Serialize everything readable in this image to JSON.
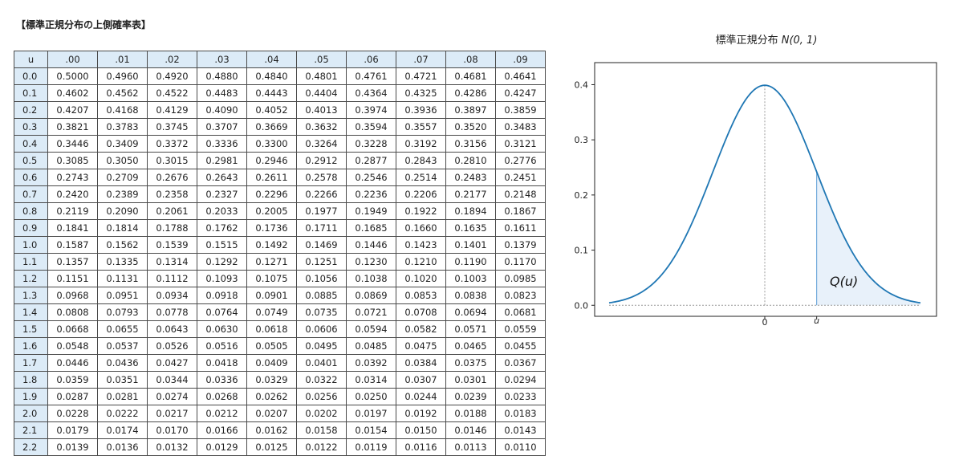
{
  "document": {
    "title": "【標準正規分布の上側確率表】"
  },
  "table": {
    "corner_label": "u",
    "column_headers": [
      ".00",
      ".01",
      ".02",
      ".03",
      ".04",
      ".05",
      ".06",
      ".07",
      ".08",
      ".09"
    ],
    "rows": [
      {
        "u": "0.0",
        "values": [
          "0.5000",
          "0.4960",
          "0.4920",
          "0.4880",
          "0.4840",
          "0.4801",
          "0.4761",
          "0.4721",
          "0.4681",
          "0.4641"
        ]
      },
      {
        "u": "0.1",
        "values": [
          "0.4602",
          "0.4562",
          "0.4522",
          "0.4483",
          "0.4443",
          "0.4404",
          "0.4364",
          "0.4325",
          "0.4286",
          "0.4247"
        ]
      },
      {
        "u": "0.2",
        "values": [
          "0.4207",
          "0.4168",
          "0.4129",
          "0.4090",
          "0.4052",
          "0.4013",
          "0.3974",
          "0.3936",
          "0.3897",
          "0.3859"
        ]
      },
      {
        "u": "0.3",
        "values": [
          "0.3821",
          "0.3783",
          "0.3745",
          "0.3707",
          "0.3669",
          "0.3632",
          "0.3594",
          "0.3557",
          "0.3520",
          "0.3483"
        ]
      },
      {
        "u": "0.4",
        "values": [
          "0.3446",
          "0.3409",
          "0.3372",
          "0.3336",
          "0.3300",
          "0.3264",
          "0.3228",
          "0.3192",
          "0.3156",
          "0.3121"
        ]
      },
      {
        "u": "0.5",
        "values": [
          "0.3085",
          "0.3050",
          "0.3015",
          "0.2981",
          "0.2946",
          "0.2912",
          "0.2877",
          "0.2843",
          "0.2810",
          "0.2776"
        ]
      },
      {
        "u": "0.6",
        "values": [
          "0.2743",
          "0.2709",
          "0.2676",
          "0.2643",
          "0.2611",
          "0.2578",
          "0.2546",
          "0.2514",
          "0.2483",
          "0.2451"
        ]
      },
      {
        "u": "0.7",
        "values": [
          "0.2420",
          "0.2389",
          "0.2358",
          "0.2327",
          "0.2296",
          "0.2266",
          "0.2236",
          "0.2206",
          "0.2177",
          "0.2148"
        ]
      },
      {
        "u": "0.8",
        "values": [
          "0.2119",
          "0.2090",
          "0.2061",
          "0.2033",
          "0.2005",
          "0.1977",
          "0.1949",
          "0.1922",
          "0.1894",
          "0.1867"
        ]
      },
      {
        "u": "0.9",
        "values": [
          "0.1841",
          "0.1814",
          "0.1788",
          "0.1762",
          "0.1736",
          "0.1711",
          "0.1685",
          "0.1660",
          "0.1635",
          "0.1611"
        ]
      },
      {
        "u": "1.0",
        "values": [
          "0.1587",
          "0.1562",
          "0.1539",
          "0.1515",
          "0.1492",
          "0.1469",
          "0.1446",
          "0.1423",
          "0.1401",
          "0.1379"
        ]
      },
      {
        "u": "1.1",
        "values": [
          "0.1357",
          "0.1335",
          "0.1314",
          "0.1292",
          "0.1271",
          "0.1251",
          "0.1230",
          "0.1210",
          "0.1190",
          "0.1170"
        ]
      },
      {
        "u": "1.2",
        "values": [
          "0.1151",
          "0.1131",
          "0.1112",
          "0.1093",
          "0.1075",
          "0.1056",
          "0.1038",
          "0.1020",
          "0.1003",
          "0.0985"
        ]
      },
      {
        "u": "1.3",
        "values": [
          "0.0968",
          "0.0951",
          "0.0934",
          "0.0918",
          "0.0901",
          "0.0885",
          "0.0869",
          "0.0853",
          "0.0838",
          "0.0823"
        ]
      },
      {
        "u": "1.4",
        "values": [
          "0.0808",
          "0.0793",
          "0.0778",
          "0.0764",
          "0.0749",
          "0.0735",
          "0.0721",
          "0.0708",
          "0.0694",
          "0.0681"
        ]
      },
      {
        "u": "1.5",
        "values": [
          "0.0668",
          "0.0655",
          "0.0643",
          "0.0630",
          "0.0618",
          "0.0606",
          "0.0594",
          "0.0582",
          "0.0571",
          "0.0559"
        ]
      },
      {
        "u": "1.6",
        "values": [
          "0.0548",
          "0.0537",
          "0.0526",
          "0.0516",
          "0.0505",
          "0.0495",
          "0.0485",
          "0.0475",
          "0.0465",
          "0.0455"
        ]
      },
      {
        "u": "1.7",
        "values": [
          "0.0446",
          "0.0436",
          "0.0427",
          "0.0418",
          "0.0409",
          "0.0401",
          "0.0392",
          "0.0384",
          "0.0375",
          "0.0367"
        ]
      },
      {
        "u": "1.8",
        "values": [
          "0.0359",
          "0.0351",
          "0.0344",
          "0.0336",
          "0.0329",
          "0.0322",
          "0.0314",
          "0.0307",
          "0.0301",
          "0.0294"
        ]
      },
      {
        "u": "1.9",
        "values": [
          "0.0287",
          "0.0281",
          "0.0274",
          "0.0268",
          "0.0262",
          "0.0256",
          "0.0250",
          "0.0244",
          "0.0239",
          "0.0233"
        ]
      },
      {
        "u": "2.0",
        "values": [
          "0.0228",
          "0.0222",
          "0.0217",
          "0.0212",
          "0.0207",
          "0.0202",
          "0.0197",
          "0.0192",
          "0.0188",
          "0.0183"
        ]
      },
      {
        "u": "2.1",
        "values": [
          "0.0179",
          "0.0174",
          "0.0170",
          "0.0166",
          "0.0162",
          "0.0158",
          "0.0154",
          "0.0150",
          "0.0146",
          "0.0143"
        ]
      },
      {
        "u": "2.2",
        "values": [
          "0.0139",
          "0.0136",
          "0.0132",
          "0.0129",
          "0.0125",
          "0.0122",
          "0.0119",
          "0.0116",
          "0.0113",
          "0.0110"
        ]
      }
    ],
    "colors": {
      "header_bg": "#dcebf7",
      "border": "#4a4a4a"
    }
  },
  "chart_data": {
    "type": "line",
    "title_prefix": "標準正規分布 ",
    "title_math": "N(0, 1)",
    "xlabel": "",
    "ylabel": "",
    "xlim": [
      -3,
      3
    ],
    "ylim": [
      -0.02,
      0.44
    ],
    "ytick_labels": [
      "0.0",
      "0.1",
      "0.2",
      "0.3",
      "0.4"
    ],
    "ytick_values": [
      0.0,
      0.1,
      0.2,
      0.3,
      0.4
    ],
    "xtick_labels": [
      "0",
      "u"
    ],
    "xtick_values": [
      0,
      1.0
    ],
    "curve_x_range": [
      -3,
      3
    ],
    "series": [
      {
        "function": "standard normal pdf",
        "mean": 0,
        "sd": 1,
        "color": "#1f77b4"
      }
    ],
    "shaded_region": {
      "from": 1.0,
      "to": 3,
      "fill": "#e8f1fa",
      "edge": "#5b9bd5"
    },
    "area_label": "Q(u)",
    "grid": false,
    "reference_lines": {
      "vertical_at": 0,
      "horizontal_at": 0,
      "style": "dotted",
      "color": "#999999"
    }
  }
}
